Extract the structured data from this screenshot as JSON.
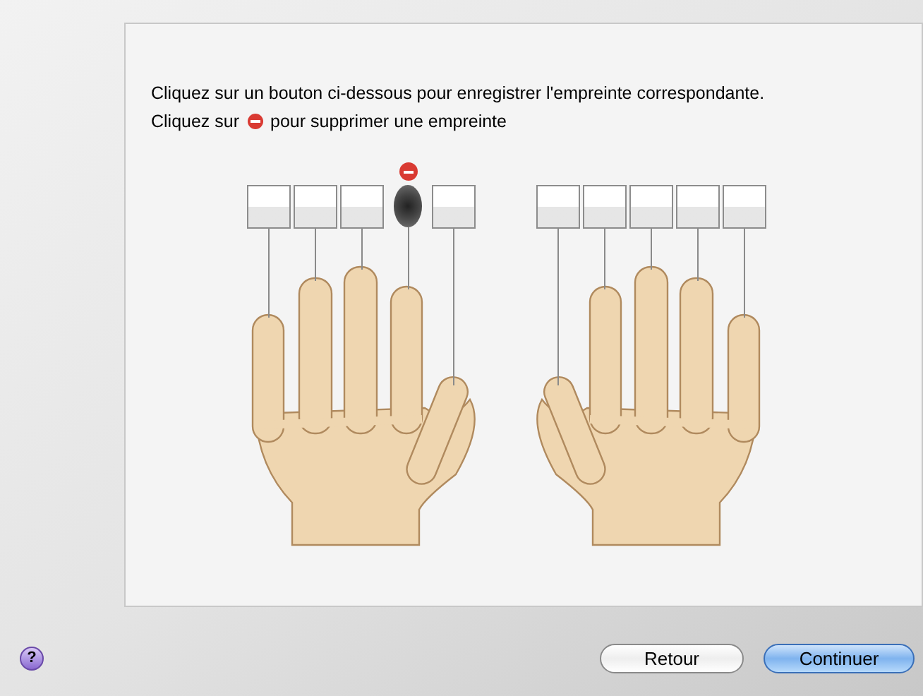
{
  "instruction": "Cliquez sur un bouton ci-dessous pour enregistrer l'empreinte correspondante.",
  "remove_hint": {
    "before": "Cliquez sur",
    "after": "pour supprimer une empreinte"
  },
  "hands": [
    {
      "fingers": [
        {
          "enrolled": false
        },
        {
          "enrolled": false
        },
        {
          "enrolled": false
        },
        {
          "enrolled": true
        },
        {
          "enrolled": false
        }
      ]
    },
    {
      "fingers": [
        {
          "enrolled": false
        },
        {
          "enrolled": false
        },
        {
          "enrolled": false
        },
        {
          "enrolled": false
        },
        {
          "enrolled": false
        }
      ]
    }
  ],
  "help_button": "?",
  "buttons": [
    {
      "label": "Retour",
      "kind": "default"
    },
    {
      "label": "Continuer",
      "kind": "primary"
    }
  ]
}
